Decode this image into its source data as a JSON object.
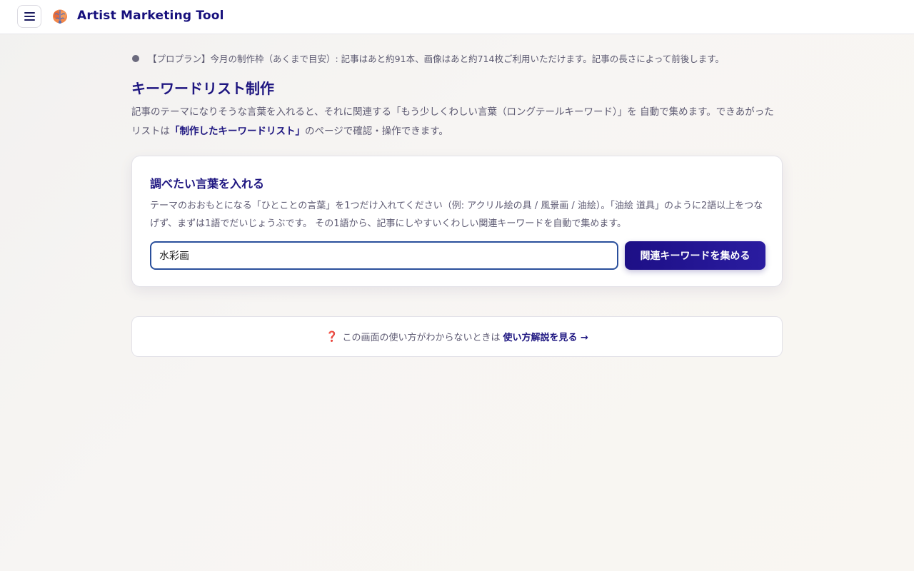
{
  "header": {
    "app_title": "Artist Marketing Tool",
    "menu_icon": "hamburger-menu-icon",
    "logo_icon": "brain-logo-icon"
  },
  "notice": {
    "text": "【プロプラン】今月の制作枠（あくまで目安）: 記事はあと約91本、画像はあと約714枚ご利用いただけます。記事の長さによって前後します。"
  },
  "page": {
    "title": "キーワードリスト制作",
    "description_part1": "記事のテーマになりそうな言葉を入れると、それに関連する「もう少しくわしい言葉（ロングテールキーワード）」を 自動で集めます。できあがったリストは",
    "description_link": "「制作したキーワードリスト」",
    "description_part2": "のページで確認・操作できます。"
  },
  "card": {
    "title": "調べたい言葉を入れる",
    "description": "テーマのおおもとになる「ひとことの言葉」を1つだけ入れてください（例: アクリル絵の具 / 風景画 / 油絵）。「油絵 道具」のように2語以上をつなげず、まずは1語でだいじょうぶです。 その1語から、記事にしやすいくわしい関連キーワードを自動で集めます。",
    "input_value": "水彩画",
    "button_label": "関連キーワードを集める"
  },
  "help": {
    "icon": "❓",
    "text": "この画面の使い方がわからないときは",
    "link_label": "使い方解説を見る →"
  },
  "colors": {
    "accent": "#1d1580",
    "button": "#1d0f86",
    "input_border": "#2a4f9c"
  }
}
